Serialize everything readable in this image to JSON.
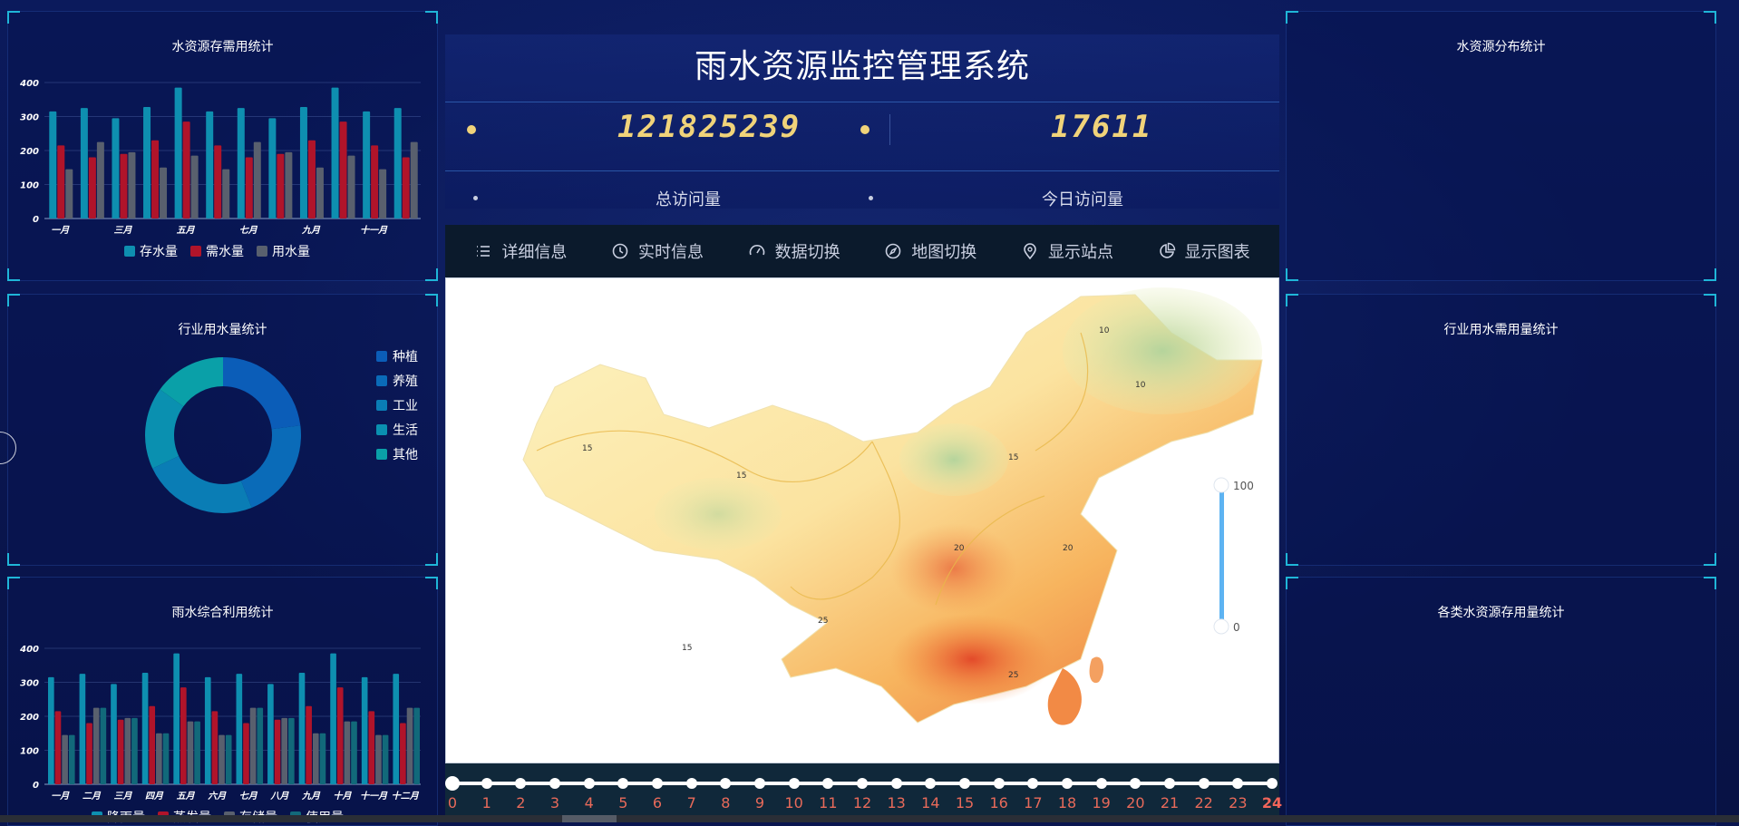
{
  "app": {
    "title": "雨水资源监控管理系统"
  },
  "stats": [
    {
      "value": "121825239",
      "label": "总访问量"
    },
    {
      "value": "17611",
      "label": "今日访问量"
    }
  ],
  "toolbar": [
    {
      "label": "详细信息",
      "icon": "list-icon"
    },
    {
      "label": "实时信息",
      "icon": "clock-icon"
    },
    {
      "label": "数据切换",
      "icon": "gauge-icon"
    },
    {
      "label": "地图切换",
      "icon": "compass-icon"
    },
    {
      "label": "显示站点",
      "icon": "location-pin-icon"
    },
    {
      "label": "显示图表",
      "icon": "pie-chart-icon"
    }
  ],
  "panels": {
    "left_top_title": "水资源存需用统计",
    "left_mid_title": "行业用水量统计",
    "left_bot_title": "雨水综合利用统计",
    "right_top_title": "水资源分布统计",
    "right_mid_title": "行业用水需用量统计",
    "right_bot_title": "各类水资源存用量统计"
  },
  "map": {
    "visual_map": {
      "max": "100",
      "min": "0"
    },
    "contour_labels": [
      "10",
      "15",
      "20",
      "25"
    ],
    "colors": {
      "low": "#fdf0b0",
      "mid": "#f7c46a",
      "high": "#e8552e",
      "green": "#b9d69a"
    }
  },
  "timeline": {
    "labels": [
      "0",
      "1",
      "2",
      "3",
      "4",
      "5",
      "6",
      "7",
      "8",
      "9",
      "10",
      "11",
      "12",
      "13",
      "14",
      "15",
      "16",
      "17",
      "18",
      "19",
      "20",
      "21",
      "22",
      "23",
      "24"
    ],
    "current": "24"
  },
  "colors": {
    "series_a": "#0e8fb0",
    "series_b": "#b0142a",
    "series_c": "#59606e",
    "series_d": "#12697a",
    "accent": "#1fb6d8",
    "digits": "#f0d37a"
  },
  "chart_data": [
    {
      "type": "bar",
      "title": "水资源存需用统计",
      "categories": [
        "一月",
        "二月",
        "三月",
        "四月",
        "五月",
        "六月",
        "七月",
        "八月",
        "九月",
        "十月",
        "十一月",
        "十二月"
      ],
      "tick_labels": [
        "一月",
        "三月",
        "五月",
        "七月",
        "九月",
        "十一月"
      ],
      "ylim": [
        0,
        400
      ],
      "yticks": [
        "0",
        "100",
        "200",
        "300",
        "400"
      ],
      "series": [
        {
          "name": "存水量",
          "values": [
            315,
            325,
            295,
            328,
            385,
            315,
            325,
            295,
            328,
            385,
            315,
            325
          ]
        },
        {
          "name": "需水量",
          "values": [
            215,
            180,
            190,
            230,
            285,
            215,
            180,
            190,
            230,
            285,
            215,
            180
          ]
        },
        {
          "name": "用水量",
          "values": [
            145,
            225,
            195,
            150,
            185,
            145,
            225,
            195,
            150,
            185,
            145,
            225
          ]
        }
      ]
    },
    {
      "type": "pie",
      "title": "行业用水量统计",
      "donut": true,
      "categories": [
        "种植",
        "养殖",
        "工业",
        "生活",
        "其他"
      ],
      "values": [
        23,
        21,
        24,
        17,
        15
      ]
    },
    {
      "type": "bar",
      "title": "雨水综合利用统计",
      "categories": [
        "一月",
        "二月",
        "三月",
        "四月",
        "五月",
        "六月",
        "七月",
        "八月",
        "九月",
        "十月",
        "十一月",
        "十二月"
      ],
      "ylim": [
        0,
        400
      ],
      "yticks": [
        "0",
        "100",
        "200",
        "300",
        "400"
      ],
      "series": [
        {
          "name": "降雨量",
          "values": [
            315,
            325,
            295,
            328,
            385,
            315,
            325,
            295,
            328,
            385,
            315,
            325
          ]
        },
        {
          "name": "蒸发量",
          "values": [
            215,
            180,
            190,
            230,
            285,
            215,
            180,
            190,
            230,
            285,
            215,
            180
          ]
        },
        {
          "name": "存储量",
          "values": [
            145,
            225,
            195,
            150,
            185,
            145,
            225,
            195,
            150,
            185,
            145,
            225
          ]
        },
        {
          "name": "使用量",
          "values": [
            145,
            225,
            195,
            150,
            185,
            145,
            225,
            195,
            150,
            185,
            145,
            225
          ]
        }
      ]
    }
  ]
}
